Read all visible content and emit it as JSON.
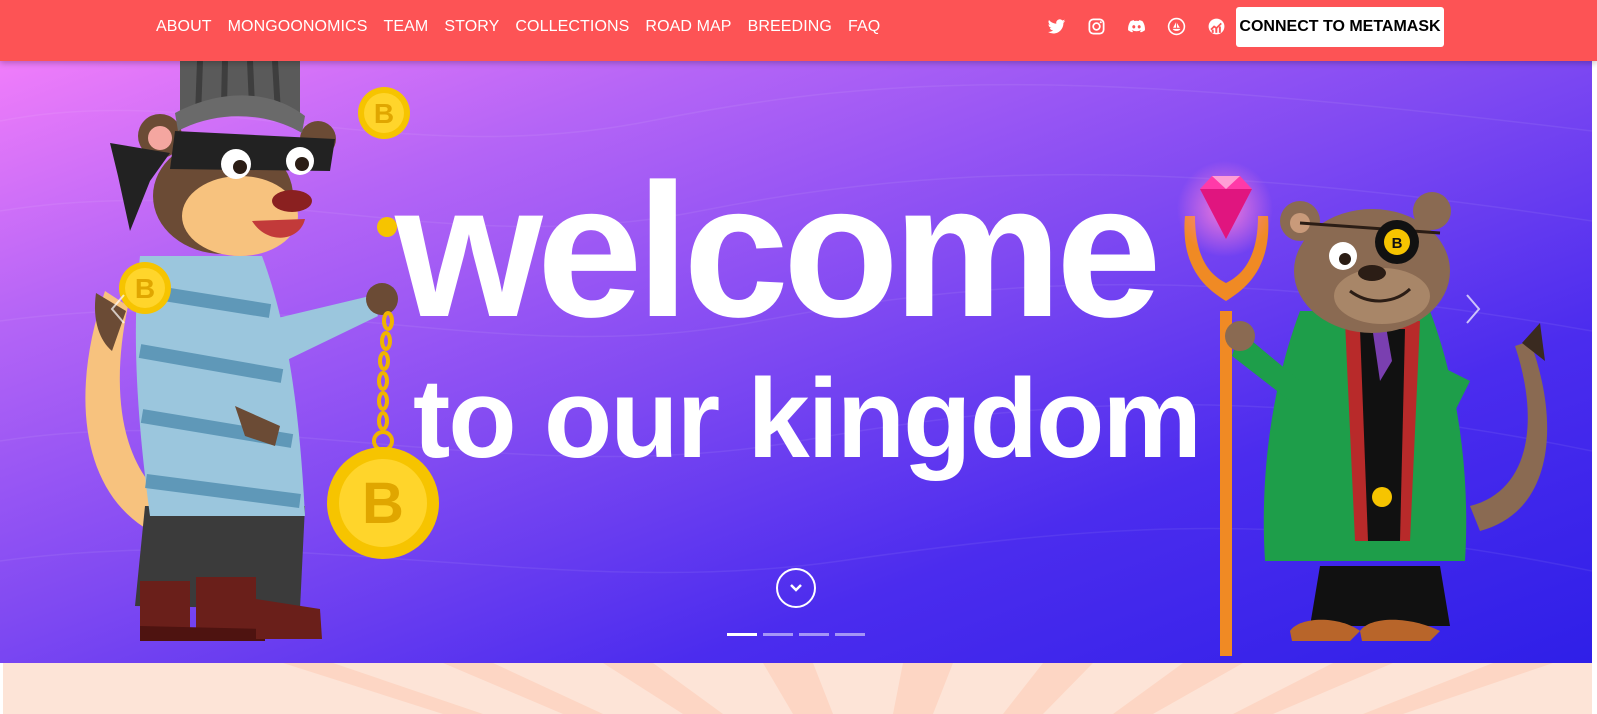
{
  "nav": {
    "links": [
      "ABOUT",
      "MONGOONOMICS",
      "TEAM",
      "STORY",
      "COLLECTIONS",
      "ROAD MAP",
      "BREEDING",
      "FAQ"
    ],
    "social_icons": [
      "twitter-icon",
      "instagram-icon",
      "discord-icon",
      "opensea-icon",
      "stats-chart-icon"
    ],
    "connect_label": "CONNECT TO METAMASK",
    "background_color": "#fd5355"
  },
  "hero": {
    "title": "welcome",
    "subtitle": "to our kingdom",
    "gradient_colors": [
      "#f07dfa",
      "#b565f6",
      "#7f49f2",
      "#4b2cee",
      "#2f1fe8"
    ],
    "prev_icon": "chevron-left-icon",
    "next_icon": "chevron-right-icon",
    "scroll_icon": "chevron-down-icon",
    "slide_count": 4,
    "active_slide": 1,
    "characters": [
      "thief-mongoose-illustration",
      "pirate-mongoose-illustration"
    ],
    "decorations": [
      "bitcoin-coin-icon",
      "pink-diamond-icon",
      "golden-scepter"
    ]
  },
  "next_section": {
    "background_color": "#fde4d7"
  }
}
